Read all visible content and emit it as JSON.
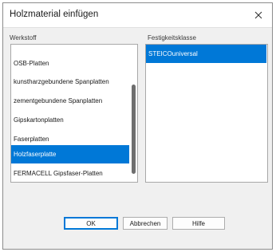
{
  "dialog": {
    "title": "Holzmaterial einfügen",
    "close_icon": "close-icon"
  },
  "werkstoff": {
    "label": "Werkstoff",
    "items": [
      {
        "label": "OSB-Platten",
        "selected": false
      },
      {
        "label": "kunstharzgebundene Spanplatten",
        "selected": false
      },
      {
        "label": "zementgebundene Spanplatten",
        "selected": false
      },
      {
        "label": "Gipskartonplatten",
        "selected": false
      },
      {
        "label": "Faserplatten",
        "selected": false
      },
      {
        "label": "Holzfaserplatte",
        "selected": true
      },
      {
        "label": "FERMACELL Gipsfaser-Platten",
        "selected": false
      }
    ]
  },
  "festigkeitsklasse": {
    "label": "Festigkeitsklasse",
    "items": [
      {
        "label": "STEICOuniversal",
        "selected": true
      }
    ]
  },
  "buttons": {
    "ok": "OK",
    "cancel": "Abbrechen",
    "help": "Hilfe"
  },
  "colors": {
    "selection": "#0078d7",
    "dialog_bg": "#f0f0f0"
  }
}
